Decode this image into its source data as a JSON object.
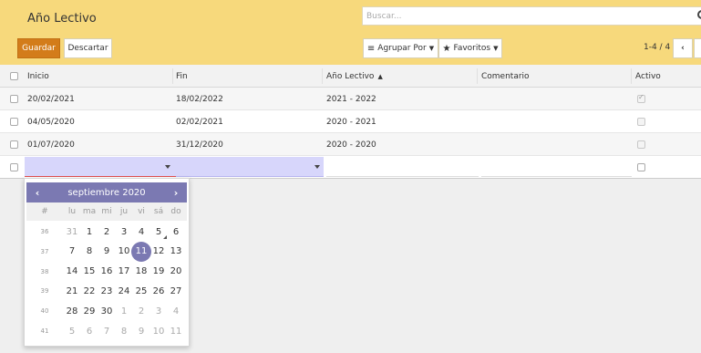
{
  "header": {
    "title": "Año Lectivo",
    "search_placeholder": "Buscar...",
    "save_label": "Guardar",
    "discard_label": "Descartar",
    "group_by_label": "Agrupar Por",
    "favorites_label": "Favoritos",
    "pager": "1-4 / 4"
  },
  "table": {
    "columns": {
      "inicio": "Inicio",
      "fin": "Fin",
      "anio": "Año Lectivo",
      "comentario": "Comentario",
      "activo": "Activo"
    },
    "rows": [
      {
        "inicio": "20/02/2021",
        "fin": "18/02/2022",
        "anio": "2021 - 2022",
        "comentario": "",
        "activo": true
      },
      {
        "inicio": "04/05/2020",
        "fin": "02/02/2021",
        "anio": "2020 - 2021",
        "comentario": "",
        "activo": false
      },
      {
        "inicio": "01/07/2020",
        "fin": "31/12/2020",
        "anio": "2020 - 2020",
        "comentario": "",
        "activo": false
      }
    ]
  },
  "datepicker": {
    "month_label": "septiembre 2020",
    "week_header": "#",
    "dows": [
      "lu",
      "ma",
      "mi",
      "ju",
      "vi",
      "sá",
      "do"
    ],
    "selected": "11",
    "today": "5",
    "weeks": [
      {
        "wk": "36",
        "days": [
          "31",
          "1",
          "2",
          "3",
          "4",
          "5",
          "6"
        ]
      },
      {
        "wk": "37",
        "days": [
          "7",
          "8",
          "9",
          "10",
          "11",
          "12",
          "13"
        ]
      },
      {
        "wk": "38",
        "days": [
          "14",
          "15",
          "16",
          "17",
          "18",
          "19",
          "20"
        ]
      },
      {
        "wk": "39",
        "days": [
          "21",
          "22",
          "23",
          "24",
          "25",
          "26",
          "27"
        ]
      },
      {
        "wk": "40",
        "days": [
          "28",
          "29",
          "30",
          "1",
          "2",
          "3",
          "4"
        ]
      },
      {
        "wk": "41",
        "days": [
          "5",
          "6",
          "7",
          "8",
          "9",
          "10",
          "11"
        ]
      }
    ],
    "old_days": [
      [
        0,
        0
      ],
      [
        4,
        3
      ],
      [
        4,
        4
      ],
      [
        4,
        5
      ],
      [
        4,
        6
      ],
      [
        5,
        0
      ],
      [
        5,
        1
      ],
      [
        5,
        2
      ],
      [
        5,
        3
      ],
      [
        5,
        4
      ],
      [
        5,
        5
      ],
      [
        5,
        6
      ]
    ]
  }
}
